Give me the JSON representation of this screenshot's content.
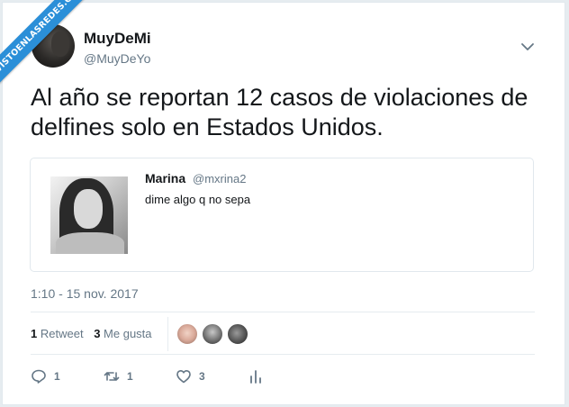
{
  "watermark": "VISTOENLASREDES.COM",
  "author": {
    "name": "MuyDeMi",
    "handle": "@MuyDeYo"
  },
  "tweet": {
    "text": "Al año se reportan 12 casos de violaciones de delfines solo en Estados Unidos."
  },
  "quoted": {
    "name": "Marina",
    "handle": "@mxrina2",
    "text": "dime algo q no sepa"
  },
  "timestamp": "1:10 - 15 nov. 2017",
  "stats": {
    "retweets_count": "1",
    "retweets_label": "Retweet",
    "likes_count": "3",
    "likes_label": "Me gusta"
  },
  "actions": {
    "reply_count": "1",
    "retweet_count": "1",
    "like_count": "3"
  },
  "icons": [
    "chevron-down-icon",
    "reply-icon",
    "retweet-icon",
    "heart-icon",
    "analytics-icon"
  ],
  "colors": {
    "accent": "#1da1f2",
    "text": "#14171a",
    "muted": "#657786",
    "ribbon": "#2b8fd8"
  }
}
